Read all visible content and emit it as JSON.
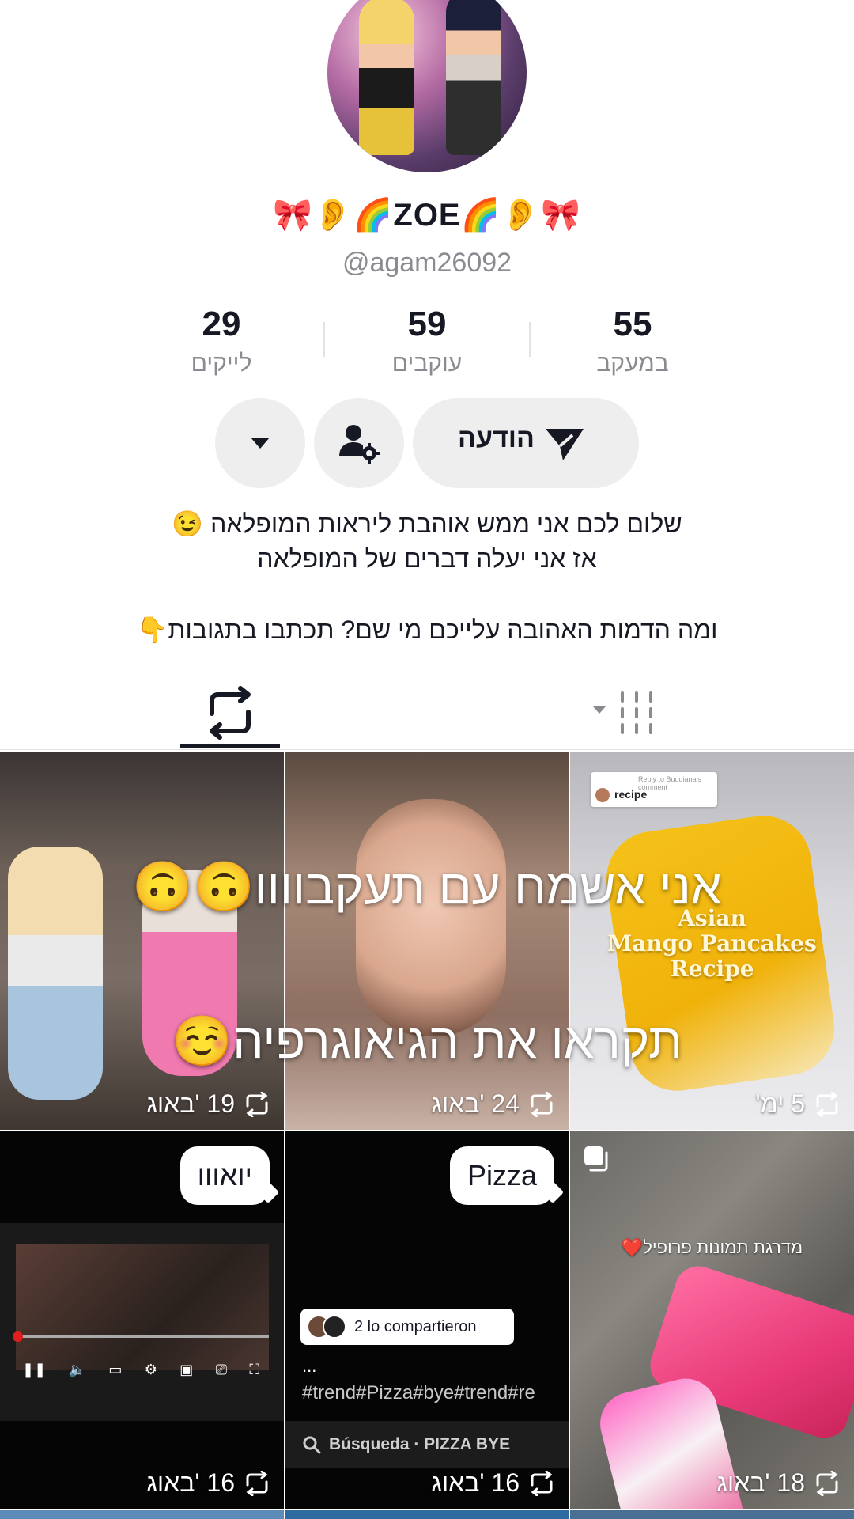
{
  "profile": {
    "username": "🎀👂🌈ZOE🌈👂🎀",
    "handle": "@agam26092"
  },
  "stats": [
    {
      "value": "55",
      "label": "במעקב"
    },
    {
      "value": "59",
      "label": "עוקבים"
    },
    {
      "value": "29",
      "label": "לייקים"
    }
  ],
  "actions": {
    "message_label": "הודעה"
  },
  "bio": {
    "line1": "שלום לכם אני ממש אוהבת ליראות המופלאה 😉",
    "line2": "אז אני יעלה דברים של המופלאה",
    "line3": "ומה הדמות האהובה עלייכם מי שם? תכתבו בתגובות👇"
  },
  "overlay": {
    "line1": "אני אשמח עם תעקבוווו🙃🙃",
    "line2": "תקראו את הגיאוגרפיה☺️"
  },
  "grid": [
    {
      "date": "19 'באוג"
    },
    {
      "date": "24 'באוג"
    },
    {
      "date": "5 ימ'"
    },
    {
      "date": "16 'באוג",
      "bubble": "יואווו"
    },
    {
      "date": "16 'באוג",
      "bubble": "Pizza"
    },
    {
      "date": "18 'באוג",
      "caption": "מדרגת תמונות פרופיל❤️"
    }
  ],
  "recipe": {
    "reply_label": "Reply to Buddiana's comment",
    "reply_text": "recipe",
    "title_line1": "Asian",
    "title_line2": "Mango Pancakes",
    "title_line3": "Recipe"
  },
  "pizza_post": {
    "shared": "2 lo compartieron",
    "dots": "...",
    "hashtags": "#trend#Pizza#bye#trend#re",
    "search": "Búsqueda · PIZZA BYE"
  },
  "colors": {
    "text": "#161823",
    "secondary": "#8a8b91",
    "button_bg": "#eeeeef"
  }
}
